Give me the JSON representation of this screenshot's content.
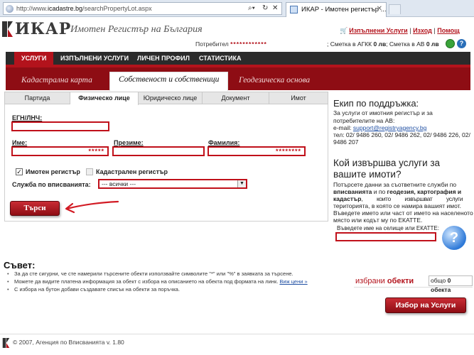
{
  "browser": {
    "url_prefix": "http://www.",
    "url_domain": "icadastre.bg",
    "url_path": "/searchPropertyLot.aspx",
    "tab_title": "ИКАР - Имотен регистър ..."
  },
  "header": {
    "logo": "ИКАР",
    "title": "Имотен Регистър на България",
    "links": [
      "Изпълнени Услуги",
      "Изход",
      "Помощ"
    ],
    "user_label": "Потребител",
    "user_value": "************",
    "acct_agkk_label": "; Сметка в АГКК",
    "acct_agkk_value": "0 лв",
    "acct_av_label": "; Сметка в АВ",
    "acct_av_value": "0 лв",
    "help_glyph": "?"
  },
  "nav": {
    "items": [
      "УСЛУГИ",
      "ИЗПЪЛНЕНИ УСЛУГИ",
      "ЛИЧЕН ПРОФИЛ",
      "СТАТИСТИКА"
    ]
  },
  "subtabs": {
    "items": [
      "Кадастрална карта",
      "Собственост и собственици",
      "Геодезическа основа"
    ]
  },
  "search_tabs": {
    "items": [
      "Партида",
      "Физическо лице",
      "Юридическо лице",
      "Документ",
      "Имот"
    ]
  },
  "form": {
    "egn_label": "ЕГН/ЛНЧ:",
    "first_name_label": "Име:",
    "first_name_value": "*****",
    "middle_name_label": "Презиме:",
    "last_name_label": "Фамилия:",
    "last_name_value": "********",
    "chk_property_label": "Имотен регистър",
    "chk_property_mark": "✓",
    "chk_cadastre_label": "Кадастрален регистър",
    "service_label": "Служба по вписванията:",
    "service_value": "--- всички ---",
    "search_button": "Търси"
  },
  "side": {
    "support_title": "Екип по поддръжка:",
    "support_text": "За услуги от имотния регистър и за потребителите на АВ:",
    "email_label": "e-mail:",
    "email": "support@registryagency.bg",
    "phones_1": "тел: 02/ 9486 260, 02/ 9486 262, 02/ 9486 226, 02/",
    "phones_2": "9486 207",
    "who_title_1": "Кой извършва услуги за",
    "who_title_2": "вашите имоти?",
    "who_text_1": "Потърсете данни за съответните служби по",
    "who_text_2_a": "вписванията",
    "who_text_2_b": " и по ",
    "who_text_2_c": "геодезия, картография и",
    "who_text_3_a": "кадастър",
    "who_text_3_b": ",          които          извършват          услуги          за",
    "who_text_4": "територията, в която се намира вашият имот.",
    "who_text_5": "Въведете името или част от името на населеното",
    "who_text_6": "място или кодът му по ЕКАТТЕ.",
    "settlement_label": "Въведете име на селище или ЕКАТТЕ:",
    "help_glyph": "?"
  },
  "tips": {
    "title": "Съвет:",
    "items": [
      "За да сте сигурни, че сте намерили търсените обекти използвайте символите \"*\" или \"%\" в заявката за търсене.",
      "Можете да видите платена информация за обект с избора на описанието на обекта под формата на линк.",
      "С избора на бутон добави създавате списък на обекти за поръчка."
    ],
    "see_link": "Виж цени »"
  },
  "selected": {
    "label_a": "избрани",
    "label_b": "обекти",
    "count_label": "общо",
    "count_value": "0 обекта",
    "choose_button": "Избор на Услуги"
  },
  "footer": {
    "text": "© 2007, Агенция по Вписванията v. 1.80"
  },
  "colors": {
    "accent": "#b3131c",
    "band": "#8e0d14",
    "nav": "#2b2b2b"
  }
}
